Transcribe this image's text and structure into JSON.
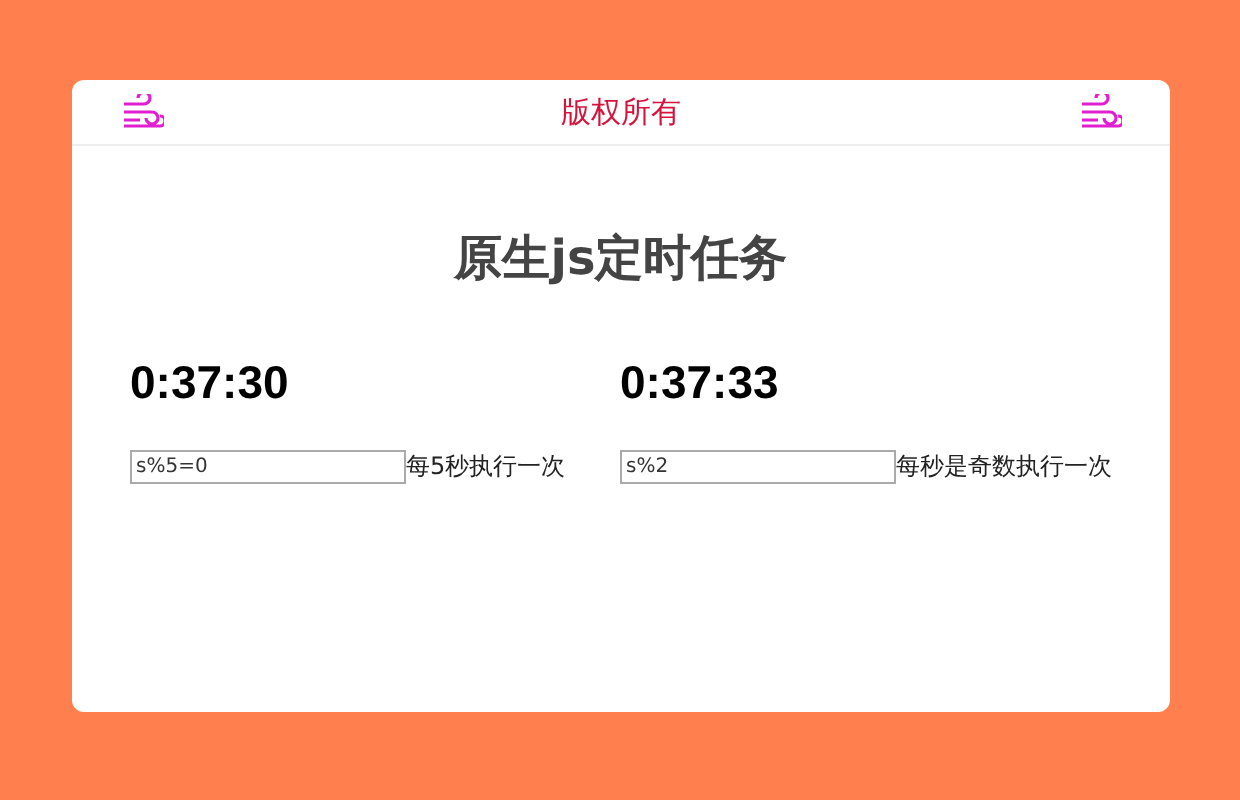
{
  "header": {
    "title": "版权所有"
  },
  "heading": "原生js定时任务",
  "timers": [
    {
      "time": "0:37:30",
      "condition": "s%5=0",
      "description": "每5秒执行一次"
    },
    {
      "time": "0:37:33",
      "condition": "s%2",
      "description": "每秒是奇数执行一次"
    }
  ]
}
